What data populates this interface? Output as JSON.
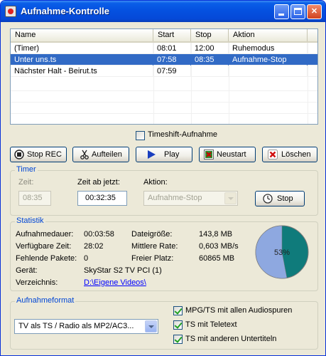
{
  "window": {
    "title": "Aufnahme-Kontrolle"
  },
  "list": {
    "columns": [
      "Name",
      "Start",
      "Stop",
      "Aktion"
    ],
    "rows": [
      {
        "name": "(Timer)",
        "start": "08:01",
        "stop": "12:00",
        "action": "Ruhemodus",
        "selected": false
      },
      {
        "name": "Unter uns.ts",
        "start": "07:58",
        "stop": "08:35",
        "action": "Aufnahme-Stop",
        "selected": true
      },
      {
        "name": "Nächster Halt - Beirut.ts",
        "start": "07:59",
        "stop": "",
        "action": "",
        "selected": false
      }
    ]
  },
  "timeshift": {
    "label": "Timeshift-Aufnahme",
    "checked": false
  },
  "buttons": {
    "stop_rec": "Stop REC",
    "split": "Aufteilen",
    "play": "Play",
    "restart": "Neustart",
    "delete": "Löschen"
  },
  "timer": {
    "title": "Timer",
    "time_label": "Zeit:",
    "time_value": "08:35",
    "from_now_label": "Zeit ab jetzt:",
    "from_now_value": "00:32:35",
    "action_label": "Aktion:",
    "action_value": "Aufnahme-Stop",
    "stop_button": "Stop"
  },
  "stats": {
    "title": "Statistik",
    "items": [
      {
        "label": "Aufnahmedauer:",
        "value": "00:03:58"
      },
      {
        "label": "Verfügbare Zeit:",
        "value": "28:02"
      },
      {
        "label": "Fehlende Pakete:",
        "value": "0"
      },
      {
        "label": "Gerät:",
        "value": "SkyStar S2 TV PCI (1)"
      },
      {
        "label": "Verzeichnis:",
        "value": "D:\\Eigene Videos\\"
      }
    ],
    "right": [
      {
        "label": "Dateigröße:",
        "value": "143,8 MB"
      },
      {
        "label": "Mittlere Rate:",
        "value": "0,603 MB/s"
      },
      {
        "label": "Freier Platz:",
        "value": "60865 MB"
      }
    ],
    "disk": {
      "used_percent": 53,
      "label": "53%",
      "colors": {
        "used": "#8EA8E0",
        "free": "#0F7B7B"
      }
    }
  },
  "format": {
    "title": "Aufnahmeformat",
    "select_value": "TV als TS / Radio als MP2/AC3...",
    "options": [
      {
        "label": "MPG/TS mit allen Audiospuren",
        "checked": true
      },
      {
        "label": "TS mit Teletext",
        "checked": true
      },
      {
        "label": "TS mit anderen Untertiteln",
        "checked": true
      }
    ]
  },
  "colors": {
    "selection": "#316AC5",
    "group_title": "#0046D5",
    "link": "#0000FF"
  }
}
